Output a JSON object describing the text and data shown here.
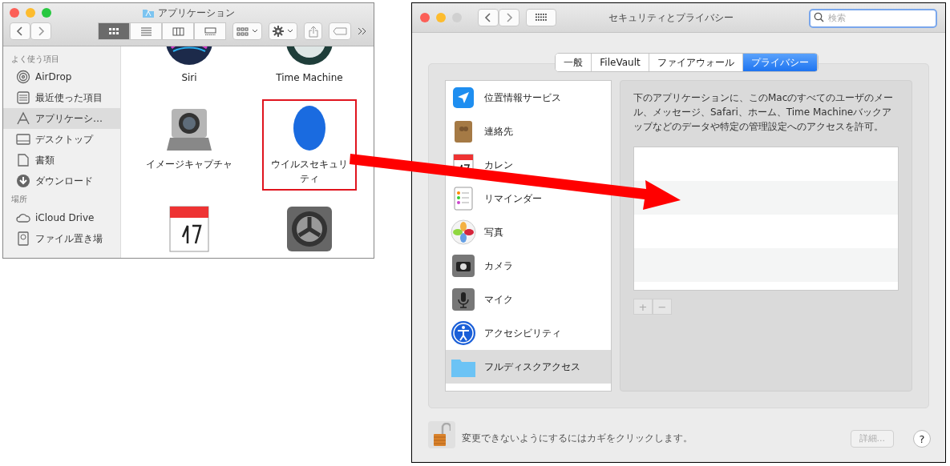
{
  "finder": {
    "title": "アプリケーション",
    "views": [
      {
        "selected": true
      },
      {
        "selected": false
      },
      {
        "selected": false
      },
      {
        "selected": false
      }
    ],
    "sidebar": [
      {
        "heading": "よく使う項目",
        "items": [
          {
            "label": "AirDrop",
            "kind": "airdrop",
            "selected": false
          },
          {
            "label": "最近使った項目",
            "kind": "recent",
            "selected": false
          },
          {
            "label": "アプリケーシ…",
            "kind": "apps",
            "selected": true
          },
          {
            "label": "デスクトップ",
            "kind": "desktop",
            "selected": false
          },
          {
            "label": "書類",
            "kind": "docs",
            "selected": false
          },
          {
            "label": "ダウンロード",
            "kind": "download",
            "selected": false
          }
        ]
      },
      {
        "heading": "場所",
        "items": [
          {
            "label": "iCloud Drive",
            "kind": "cloud",
            "selected": false
          },
          {
            "label": "ファイル置き場",
            "kind": "disk",
            "selected": false
          }
        ]
      }
    ],
    "apps": [
      {
        "label": "Siri",
        "kind": "siri",
        "highlighted": false
      },
      {
        "label": "Time Machine",
        "kind": "timemachine",
        "highlighted": false
      },
      {
        "label": "イメージキャプチャ",
        "kind": "camera",
        "highlighted": false
      },
      {
        "label": "ウイルスセキュリティ",
        "kind": "oval",
        "highlighted": true
      },
      {
        "kind": "calendar",
        "highlighted": false
      },
      {
        "kind": "gear",
        "highlighted": false
      }
    ]
  },
  "prefs": {
    "title": "セキュリティとプライバシー",
    "search": {
      "placeholder": "検索"
    },
    "tabs": [
      {
        "label": "一般",
        "selected": false
      },
      {
        "label": "FileVault",
        "selected": false
      },
      {
        "label": "ファイアウォール",
        "selected": false
      },
      {
        "label": "プライバシー",
        "selected": true
      }
    ],
    "services": [
      {
        "label": "位置情報サービス",
        "kind": "location",
        "selected": false
      },
      {
        "label": "連絡先",
        "kind": "contacts",
        "selected": false
      },
      {
        "label": "カレン",
        "kind": "calendar",
        "selected": false
      },
      {
        "label": "リマインダー",
        "kind": "reminders",
        "selected": false
      },
      {
        "label": "写真",
        "kind": "photos",
        "selected": false
      },
      {
        "label": "カメラ",
        "kind": "camera",
        "selected": false
      },
      {
        "label": "マイク",
        "kind": "mic",
        "selected": false
      },
      {
        "label": "アクセシビリティ",
        "kind": "accessibility",
        "selected": false
      },
      {
        "label": "フルディスクアクセス",
        "kind": "folder",
        "selected": true
      }
    ],
    "description": "下のアプリケーションに、このMacのすべてのユーザのメール、メッセージ、Safari、ホーム、Time Machineバックアップなどのデータや特定の管理設定へのアクセスを許可。",
    "add": "+",
    "remove": "−",
    "lock_text": "変更できないようにするにはカギをクリックします。",
    "details": "詳細...",
    "help": "?"
  }
}
